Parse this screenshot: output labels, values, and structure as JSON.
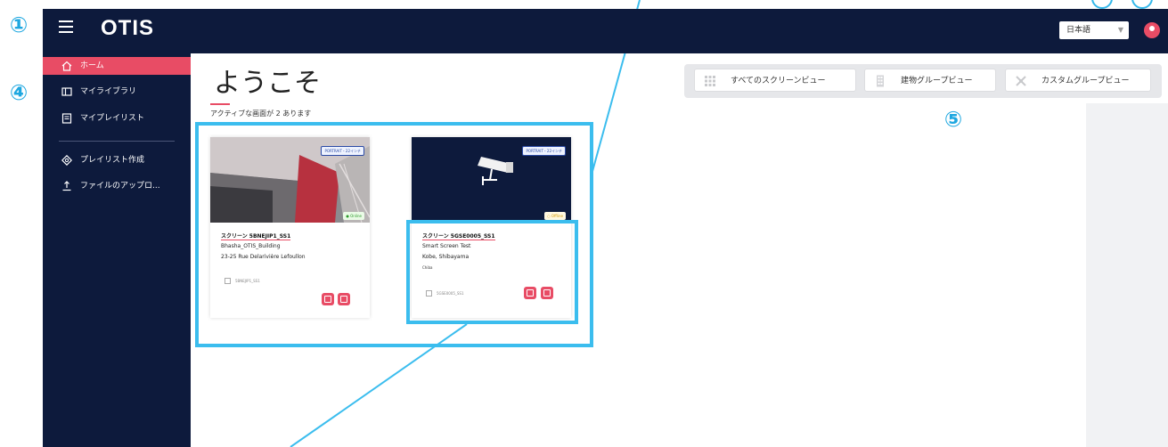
{
  "callouts": {
    "c1": "①",
    "c4": "④",
    "c5": "⑤"
  },
  "header": {
    "logo": "OTIS",
    "language": "日本語"
  },
  "sidebar": {
    "items": [
      {
        "label": "ホーム",
        "icon": "home-icon",
        "active": true
      },
      {
        "label": "マイライブラリ",
        "icon": "library-icon"
      },
      {
        "label": "マイプレイリスト",
        "icon": "playlist-icon"
      },
      {
        "label": "プレイリスト作成",
        "icon": "create-playlist-icon"
      },
      {
        "label": "ファイルのアップロ...",
        "icon": "upload-icon"
      }
    ]
  },
  "main": {
    "title": "ようこそ",
    "subtitle": "アクティブな画面が 2 あります"
  },
  "tabs": [
    {
      "label": "すべてのスクリーンビュー",
      "icon": "grid-icon"
    },
    {
      "label": "建物グループビュー",
      "icon": "building-icon"
    },
    {
      "label": "カスタムグループビュー",
      "icon": "custom-group-icon"
    }
  ],
  "cards": [
    {
      "badge": "PORTRAIT・22インチ",
      "status": "● Online",
      "title": "スクリーン 5BNEJIP1_SS1",
      "building": "Bhasha_OTIS_Building",
      "address": "23-25 Rue Delarivière Lefoullon",
      "id": "5BNEJIP1_SS1"
    },
    {
      "badge": "PORTRAIT・22インチ",
      "status": "○ Offline",
      "title": "スクリーン 5GSE0005_SS1",
      "name": "Smart Screen Test",
      "location": "Kobe, Shibayama",
      "city": "Chiba",
      "id": "5GSE0005_SS1"
    }
  ],
  "colors": {
    "navy": "#0d1a3c",
    "accent": "#e84c65",
    "highlight": "#3bbdee"
  }
}
